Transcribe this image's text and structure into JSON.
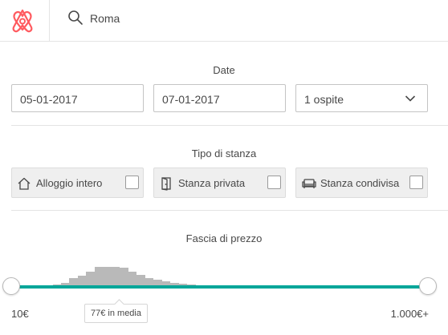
{
  "header": {
    "logo_icon": "airbnb-logo-icon",
    "brand_color": "#ff5a5f",
    "search_icon": "search-icon",
    "search_value": "Roma"
  },
  "dates": {
    "title": "Date",
    "checkin": "05-01-2017",
    "checkout": "07-01-2017",
    "guests": "1 ospite"
  },
  "room_type": {
    "title": "Tipo di stanza",
    "options": [
      {
        "label": "Alloggio intero",
        "icon": "house-icon",
        "checked": false
      },
      {
        "label": "Stanza privata",
        "icon": "door-icon",
        "checked": false
      },
      {
        "label": "Stanza condivisa",
        "icon": "sofa-icon",
        "checked": false
      }
    ]
  },
  "price": {
    "title": "Fascia di prezzo",
    "min": "10€",
    "max": "1.000€+",
    "average": "77€ in media",
    "accent_color": "#00a699",
    "histogram_color": "#b9b9b9"
  }
}
